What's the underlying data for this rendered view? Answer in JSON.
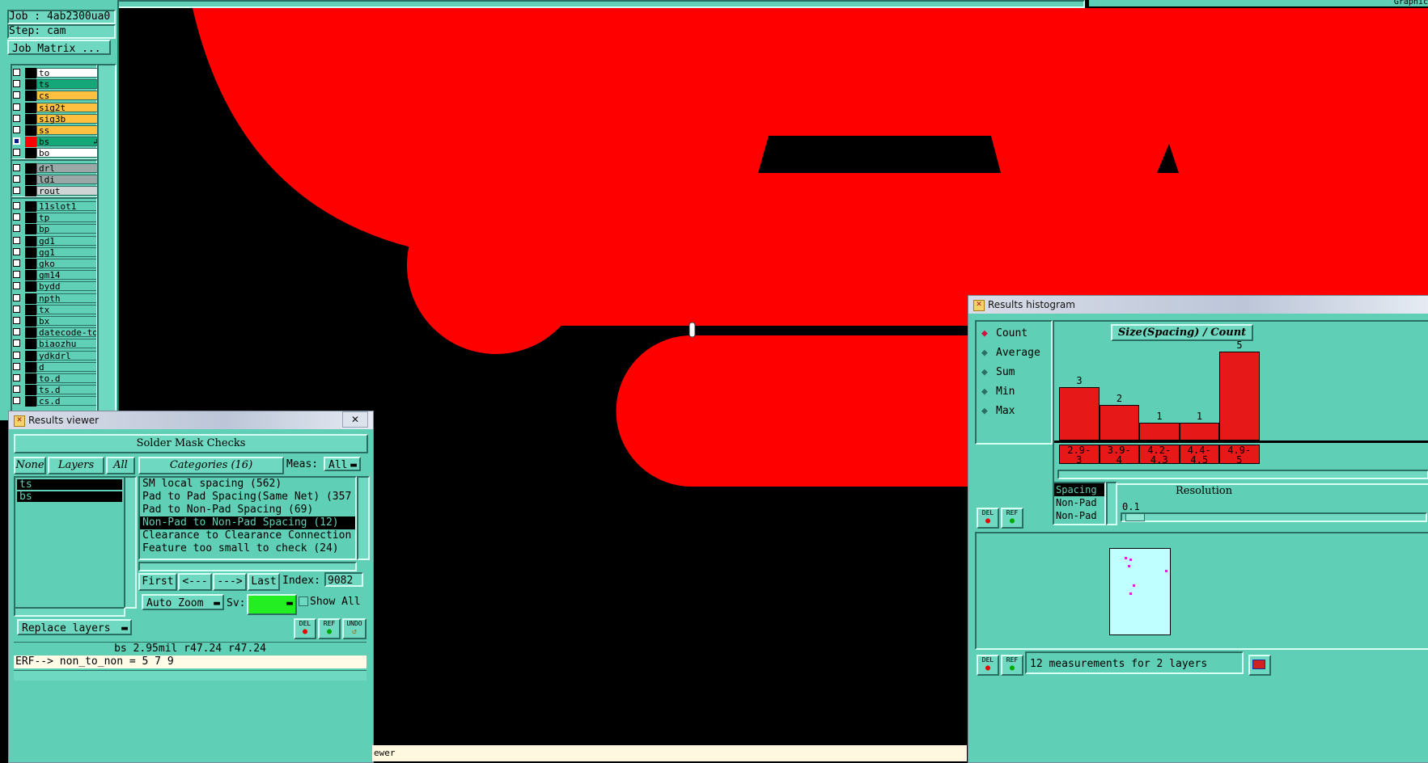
{
  "job_panel": {
    "job_label": "Job : 4ab2300ua0",
    "step_label": "Step: cam",
    "job_matrix_button": "Job Matrix ..."
  },
  "layers": {
    "group1": [
      {
        "name": "to",
        "color": "#ffffff",
        "flag": "↲"
      },
      {
        "name": "ts",
        "color": "#14a878",
        "flag": "↲"
      },
      {
        "name": "cs",
        "color": "#ffc040",
        "flag": "↲"
      },
      {
        "name": "sig2t",
        "color": "#ffc040",
        "flag": "↲"
      },
      {
        "name": "sig3b",
        "color": "#ffc040",
        "flag": "↲"
      },
      {
        "name": "ss",
        "color": "#ffc040",
        "flag": "↲"
      },
      {
        "name": "bs",
        "color": "#14a878",
        "flag": "↲⊞",
        "selected": true
      },
      {
        "name": "bo",
        "color": "#ffffff",
        "flag": "↲"
      }
    ],
    "group2": [
      {
        "name": "drl",
        "color": "#9aa8a8"
      },
      {
        "name": "ldi",
        "color": "#9aa8a8"
      },
      {
        "name": "rout",
        "color": "#cfd4d4"
      }
    ],
    "group3": [
      {
        "name": "11slot1",
        "flag": ""
      },
      {
        "name": "tp",
        "flag": ""
      },
      {
        "name": "bp",
        "flag": ""
      },
      {
        "name": "gd1",
        "flag": ""
      },
      {
        "name": "gg1",
        "flag": ""
      },
      {
        "name": "gko",
        "flag": ""
      },
      {
        "name": "gm14",
        "flag": ""
      },
      {
        "name": "bydd",
        "flag": ""
      },
      {
        "name": "npth",
        "flag": ""
      },
      {
        "name": "tx",
        "flag": ""
      },
      {
        "name": "bx",
        "flag": ""
      },
      {
        "name": "datecode-to",
        "flag": ""
      },
      {
        "name": "biaozhu",
        "flag": ""
      },
      {
        "name": "ydkdrl",
        "flag": ""
      },
      {
        "name": "d",
        "flag": ""
      },
      {
        "name": "to.d",
        "flag": "↲"
      },
      {
        "name": "ts.d",
        "flag": "↲"
      },
      {
        "name": "cs.d",
        "flag": "↲"
      }
    ]
  },
  "top_bar": {
    "right_label": "Graphic"
  },
  "results_viewer": {
    "title": "Results viewer",
    "close": "✕",
    "header": "Solder Mask Checks",
    "none_btn": "None",
    "layers_btn": "Layers",
    "all_btn": "All",
    "layer_list": [
      "ts",
      "bs"
    ],
    "categories_btn": "Categories (16)",
    "meas_label": "Meas:",
    "meas_value": "All",
    "categories": [
      {
        "label": "SM local spacing (562)"
      },
      {
        "label": "Pad to Pad Spacing(Same Net) (357"
      },
      {
        "label": "Pad to Non-Pad Spacing (69)"
      },
      {
        "label": "Non-Pad to Non-Pad Spacing (12)",
        "selected": true
      },
      {
        "label": "Clearance to Clearance Connection"
      },
      {
        "label": "Feature too small to check (24)"
      }
    ],
    "nav": {
      "first": "First",
      "prev": "<---",
      "next": "--->",
      "last": "Last",
      "index_label": "Index:",
      "index_value": "9082"
    },
    "auto_zoom": "Auto Zoom",
    "sv_label": "Sv:",
    "show_all": "Show All",
    "replace_layers": "Replace layers",
    "del": "DEL",
    "ref": "REF",
    "undo": "UNDO",
    "status": "bs 2.95mil  r47.24  r47.24",
    "erf": "ERF--> non_to_non = 5 7 9",
    "bottom_label": "ewer"
  },
  "histogram": {
    "title": "Results histogram",
    "options": [
      {
        "label": "Count",
        "selected": true
      },
      {
        "label": "Average"
      },
      {
        "label": "Sum"
      },
      {
        "label": "Min"
      },
      {
        "label": "Max"
      }
    ],
    "chart_title": "Size(Spacing) / Count",
    "del": "DEL",
    "ref": "REF",
    "measures": [
      "Spacing",
      "Non-Pad",
      "Non-Pad"
    ],
    "resolution_label": "Resolution",
    "resolution_value": "0.1",
    "footer": "12 measurements for 2 layers"
  },
  "chart_data": {
    "type": "bar",
    "title": "Size(Spacing) / Count",
    "categories": [
      "2.9-3",
      "3.9-4",
      "4.2-4.3",
      "4.4-4.5",
      "4.9-5"
    ],
    "values": [
      3,
      2,
      1,
      1,
      5
    ],
    "ylim": [
      0,
      5
    ]
  }
}
